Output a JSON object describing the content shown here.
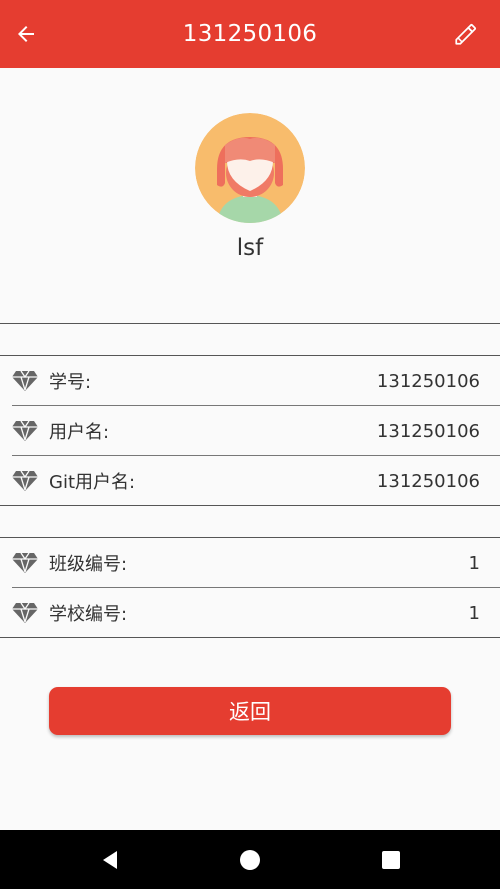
{
  "header": {
    "title": "131250106",
    "back_icon": "arrow-left-icon",
    "edit_icon": "pencil-icon"
  },
  "profile": {
    "username": "lsf",
    "avatar_icon": "girl-avatar-icon"
  },
  "info_group1": [
    {
      "label": "学号:",
      "value": "131250106",
      "icon": "diamond-icon"
    },
    {
      "label": "用户名:",
      "value": "131250106",
      "icon": "diamond-icon"
    },
    {
      "label": "Git用户名:",
      "value": "131250106",
      "icon": "diamond-icon"
    }
  ],
  "info_group2": [
    {
      "label": "班级编号:",
      "value": "1",
      "icon": "diamond-icon"
    },
    {
      "label": "学校编号:",
      "value": "1",
      "icon": "diamond-icon"
    }
  ],
  "actions": {
    "return_label": "返回"
  },
  "colors": {
    "accent": "#e53d30",
    "background": "#fafafa"
  },
  "navbar": {
    "back": "triangle-back-icon",
    "home": "circle-home-icon",
    "recents": "square-recents-icon"
  }
}
